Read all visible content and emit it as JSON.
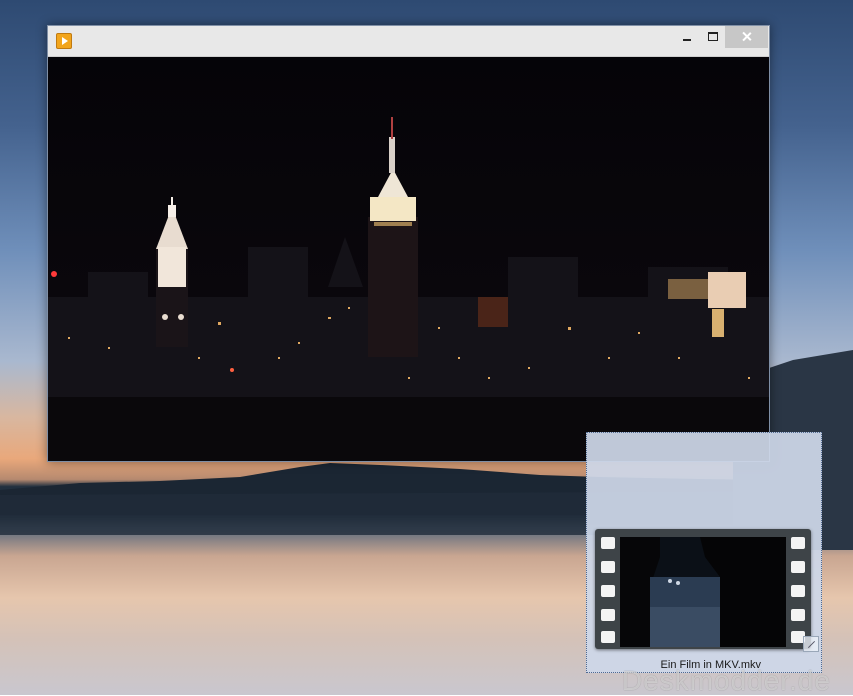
{
  "window": {
    "app_icon": "media-player-icon",
    "controls": [
      "minimize-icon",
      "maximize-icon",
      "close-icon"
    ]
  },
  "video": {
    "content": "night city skyline"
  },
  "preview": {
    "caption": "Ein Film in MKV.mkv"
  },
  "watermark": "Deskmodder.de",
  "colors": {
    "titlebar": "#e8e8e8",
    "close_button": "#c7c7c7",
    "preview_background": "#cdd7e8"
  }
}
